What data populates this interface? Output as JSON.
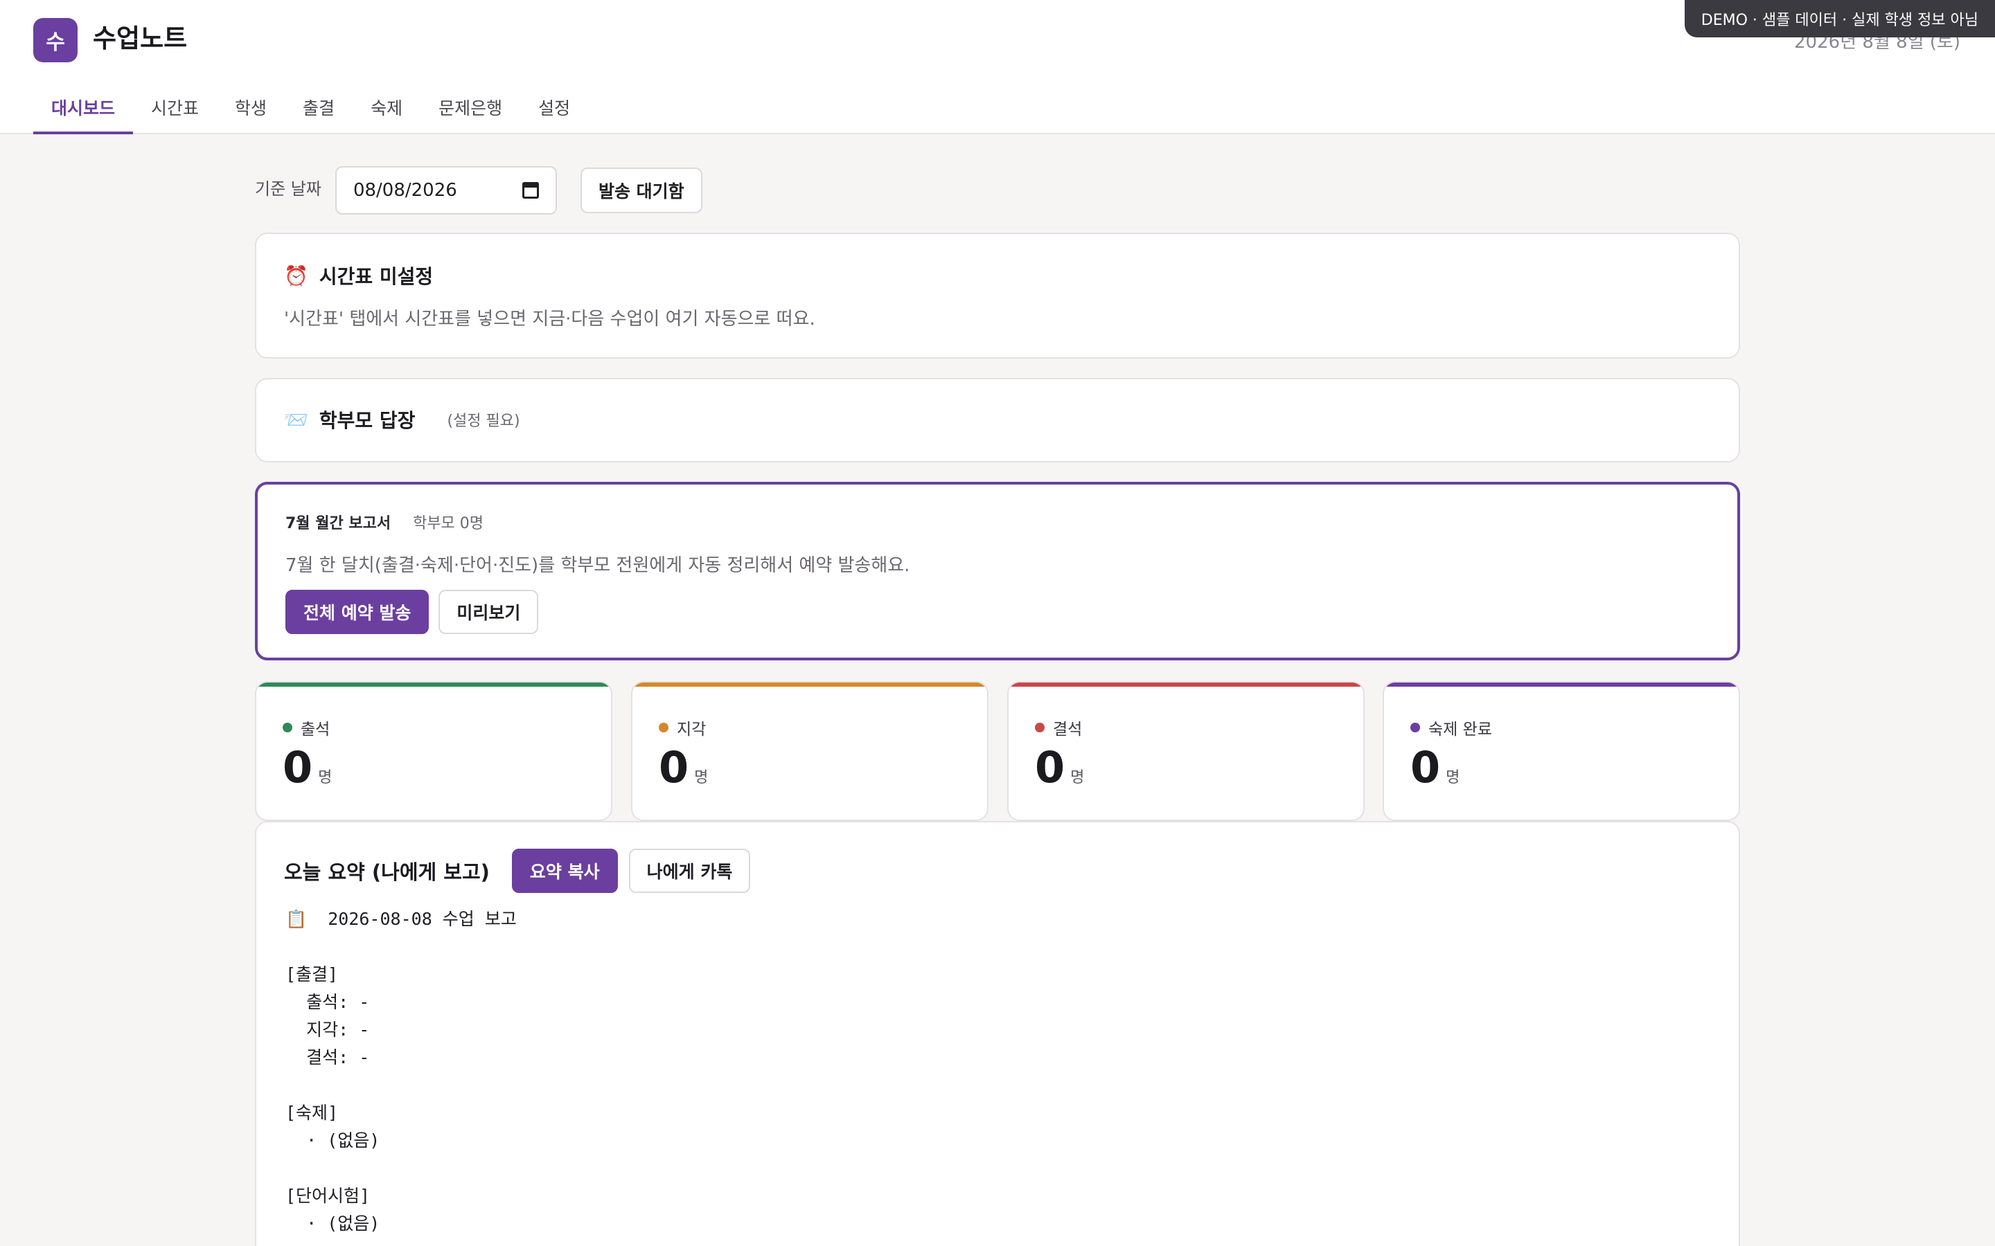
{
  "app": {
    "logo_letter": "수",
    "title": "수업노트",
    "date_display": "2026년 8월 8일 (토)",
    "demo_badge": "DEMO · 샘플 데이터 · 실제 학생 정보 아님"
  },
  "tabs": [
    {
      "label": "대시보드",
      "active": true
    },
    {
      "label": "시간표"
    },
    {
      "label": "학생"
    },
    {
      "label": "출결"
    },
    {
      "label": "숙제"
    },
    {
      "label": "문제은행"
    },
    {
      "label": "설정"
    }
  ],
  "controls": {
    "date_label": "기준 날짜",
    "date_value": "08/08/2026",
    "outbox_button": "발송 대기함"
  },
  "timetable_card": {
    "emoji": "⏰",
    "title": "시간표 미설정",
    "text": "'시간표' 탭에서 시간표를 넣으면 지금·다음 수업이 여기 자동으로 떠요."
  },
  "parent_reply_card": {
    "emoji": "📨",
    "title": "학부모 답장",
    "note": "(설정 필요)"
  },
  "monthly_report": {
    "title": "7월 월간 보고서",
    "parent_count": "학부모 0명",
    "text": "7월 한 달치(출결·숙제·단어·진도)를 학부모 전원에게 자동 정리해서 예약 발송해요.",
    "schedule_button": "전체 예약 발송",
    "preview_button": "미리보기"
  },
  "stats": [
    {
      "label": "출석",
      "value": "0",
      "unit": "명",
      "color": "#2e8a57"
    },
    {
      "label": "지각",
      "value": "0",
      "unit": "명",
      "color": "#d4882a"
    },
    {
      "label": "결석",
      "value": "0",
      "unit": "명",
      "color": "#c94848"
    },
    {
      "label": "숙제 완료",
      "value": "0",
      "unit": "명",
      "color": "#6b3fa0"
    }
  ],
  "summary": {
    "title": "오늘 요약 (나에게 보고)",
    "copy_button": "요약 복사",
    "kakao_button": "나에게 카톡",
    "text": "📋  2026-08-08 수업 보고\n\n[출결]\n  출석: -\n  지각: -\n  결석: -\n\n[숙제]\n  · (없음)\n\n[단어시험]\n  · (없음)"
  }
}
